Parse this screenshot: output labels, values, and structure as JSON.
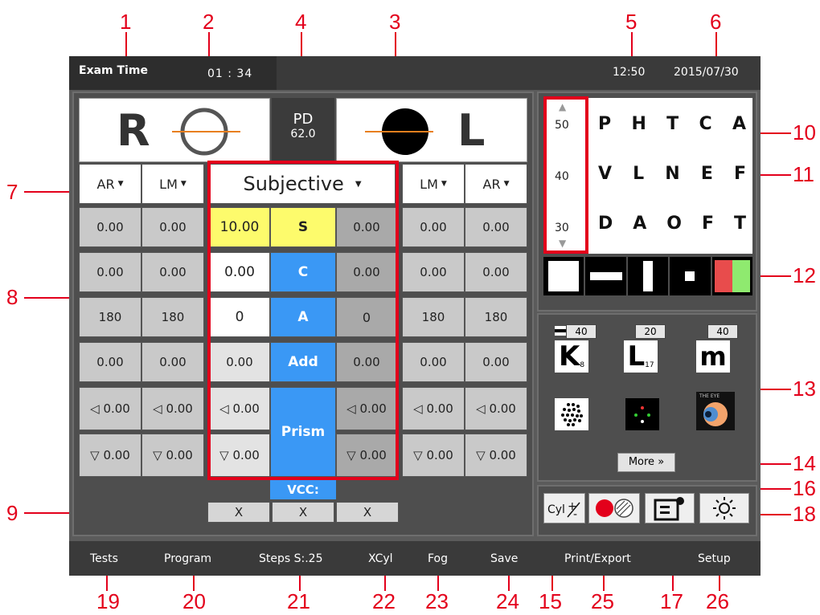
{
  "topbar": {
    "exam_time_label": "Exam Time",
    "exam_time": "01 : 34",
    "clock": "12:50",
    "date": "2015/07/30"
  },
  "eyes": {
    "right": "R",
    "left": "L",
    "pd_label": "PD",
    "pd_value": "62.0"
  },
  "columns": {
    "r_ar": "AR",
    "r_lm": "LM",
    "mode": "Subjective",
    "l_lm": "LM",
    "l_ar": "AR"
  },
  "rows": [
    {
      "r_ar": "0.00",
      "r_lm": "0.00",
      "r_sub": "10.00",
      "label": "S",
      "l_sub": "0.00",
      "l_lm": "0.00",
      "l_ar": "0.00"
    },
    {
      "r_ar": "0.00",
      "r_lm": "0.00",
      "r_sub": "0.00",
      "label": "C",
      "l_sub": "0.00",
      "l_lm": "0.00",
      "l_ar": "0.00"
    },
    {
      "r_ar": "180",
      "r_lm": "180",
      "r_sub": "0",
      "label": "A",
      "l_sub": "0",
      "l_lm": "180",
      "l_ar": "180"
    },
    {
      "r_ar": "0.00",
      "r_lm": "0.00",
      "r_sub": "0.00",
      "label": "Add",
      "l_sub": "0.00",
      "l_lm": "0.00",
      "l_ar": "0.00"
    },
    {
      "r_ar": "◁ 0.00",
      "r_lm": "◁ 0.00",
      "r_sub": "◁ 0.00",
      "label": "Prism",
      "l_sub": "◁ 0.00",
      "l_lm": "◁ 0.00",
      "l_ar": "◁ 0.00"
    },
    {
      "r_ar": "▽ 0.00",
      "r_lm": "▽ 0.00",
      "r_sub": "▽ 0.00",
      "l_sub": "▽ 0.00",
      "l_lm": "▽ 0.00",
      "l_ar": "▽ 0.00"
    }
  ],
  "vcc": {
    "label": "VCC:",
    "x1": "X",
    "x2": "X",
    "x3": "X"
  },
  "acuity": {
    "scale": [
      "50",
      "40",
      "30"
    ],
    "row1": [
      "P",
      "H",
      "T",
      "C",
      "A"
    ],
    "row2": [
      "V",
      "L",
      "N",
      "E",
      "F"
    ],
    "row3": [
      "D",
      "A",
      "O",
      "F",
      "T"
    ]
  },
  "tests": {
    "k_num": "40",
    "k_letter": "K",
    "k_sub": "8",
    "l_num": "20",
    "l_letter": "L",
    "l_sub": "17",
    "m_num": "40",
    "m_letter": "m",
    "eye_label": "THE EYE",
    "more": "More »"
  },
  "bottombar": [
    "Tests",
    "Program",
    "Steps S:.25",
    "XCyl",
    "Fog",
    "Save",
    "Print/Export",
    "Setup"
  ],
  "callouts": {
    "top": [
      "1",
      "2",
      "4",
      "3",
      "5",
      "6"
    ],
    "left": [
      "7",
      "8",
      "9"
    ],
    "right": [
      "10",
      "11",
      "12",
      "13",
      "14",
      "16",
      "18"
    ],
    "bottom": [
      "19",
      "20",
      "21",
      "22",
      "23",
      "24",
      "15",
      "25",
      "17",
      "26"
    ]
  },
  "colors": {
    "callout": "#e3001b",
    "subjective_blue": "#3a98f5",
    "sphere_yellow": "#fdfb6c"
  }
}
